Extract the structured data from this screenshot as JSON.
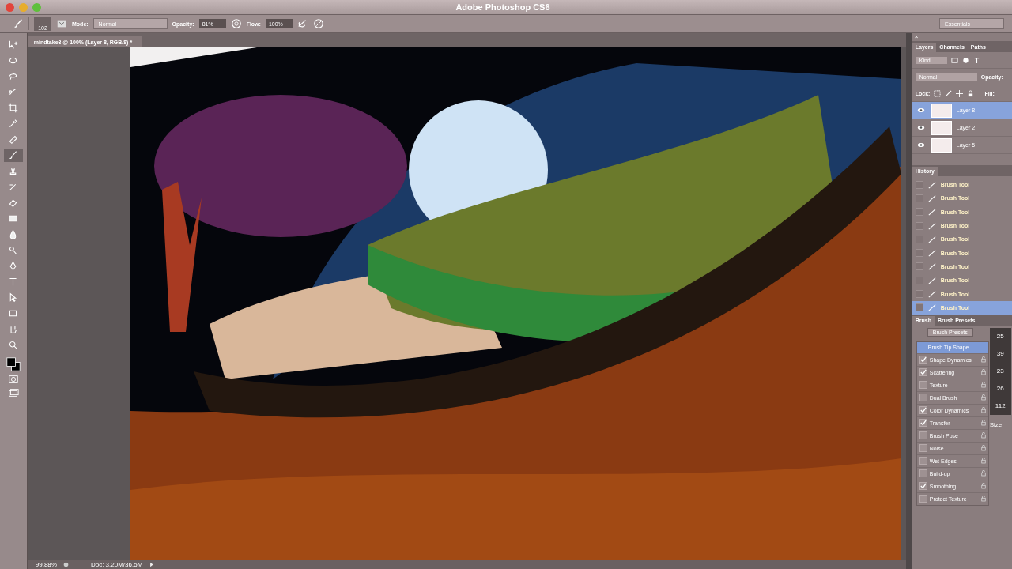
{
  "window": {
    "title": "Adobe Photoshop CS6"
  },
  "options_bar": {
    "brush_size": "102",
    "mode_label": "Mode:",
    "mode": "Normal",
    "opacity_label": "Opacity:",
    "opacity": "81%",
    "flow_label": "Flow:",
    "flow": "100%",
    "workspace": "Essentials"
  },
  "document_tab": {
    "title": "mindtake3 @ 100% (Layer 8, RGB/8) *"
  },
  "tools": [
    {
      "kind": "move",
      "selected": false
    },
    {
      "kind": "marquee",
      "selected": false
    },
    {
      "kind": "lasso",
      "selected": false
    },
    {
      "kind": "quick-select",
      "selected": false
    },
    {
      "kind": "crop",
      "selected": false
    },
    {
      "kind": "eyedropper",
      "selected": false
    },
    {
      "kind": "healing",
      "selected": false
    },
    {
      "kind": "brush",
      "selected": true
    },
    {
      "kind": "stamp",
      "selected": false
    },
    {
      "kind": "history-brush",
      "selected": false
    },
    {
      "kind": "eraser",
      "selected": false
    },
    {
      "kind": "gradient",
      "selected": false
    },
    {
      "kind": "blur",
      "selected": false
    },
    {
      "kind": "dodge",
      "selected": false
    },
    {
      "kind": "pen",
      "selected": false
    },
    {
      "kind": "type",
      "selected": false
    },
    {
      "kind": "path-select",
      "selected": false
    },
    {
      "kind": "shape",
      "selected": false
    },
    {
      "kind": "hand",
      "selected": false
    },
    {
      "kind": "zoom",
      "selected": false
    }
  ],
  "layers_panel": {
    "close": "×",
    "tabs": [
      {
        "label": "Layers",
        "selected": true
      },
      {
        "label": "Channels",
        "selected": false
      },
      {
        "label": "Paths",
        "selected": false
      }
    ],
    "filter": "Kind",
    "blend_mode": "Normal",
    "opacity_label": "Opacity:",
    "lock_label": "Lock:",
    "fill_label": "Fill:",
    "layers": [
      {
        "name": "Layer 8",
        "visible": true,
        "selected": true
      },
      {
        "name": "Layer 2",
        "visible": true,
        "selected": false
      },
      {
        "name": "Layer 5",
        "visible": true,
        "selected": false
      }
    ]
  },
  "history_panel": {
    "title": "History",
    "items": [
      {
        "label": "Brush Tool",
        "selected": false
      },
      {
        "label": "Brush Tool",
        "selected": false
      },
      {
        "label": "Brush Tool",
        "selected": false
      },
      {
        "label": "Brush Tool",
        "selected": false
      },
      {
        "label": "Brush Tool",
        "selected": false
      },
      {
        "label": "Brush Tool",
        "selected": false
      },
      {
        "label": "Brush Tool",
        "selected": false
      },
      {
        "label": "Brush Tool",
        "selected": false
      },
      {
        "label": "Brush Tool",
        "selected": false
      },
      {
        "label": "Brush Tool",
        "selected": true
      }
    ]
  },
  "brush_panel": {
    "tabs": [
      {
        "label": "Brush",
        "selected": true
      },
      {
        "label": "Brush Presets",
        "selected": false
      }
    ],
    "presets_button": "Brush Presets",
    "options": [
      {
        "kind": "heading",
        "label": "Brush Tip Shape",
        "selected": true
      },
      {
        "kind": "option",
        "label": "Shape Dynamics",
        "checked": true
      },
      {
        "kind": "option",
        "label": "Scattering",
        "checked": true
      },
      {
        "kind": "option",
        "label": "Texture",
        "checked": false
      },
      {
        "kind": "option",
        "label": "Dual Brush",
        "checked": false
      },
      {
        "kind": "option",
        "label": "Color Dynamics",
        "checked": true
      },
      {
        "kind": "option",
        "label": "Transfer",
        "checked": true
      },
      {
        "kind": "option",
        "label": "Brush Pose",
        "checked": false
      },
      {
        "kind": "option",
        "label": "Noise",
        "checked": false
      },
      {
        "kind": "option",
        "label": "Wet Edges",
        "checked": false
      },
      {
        "kind": "option",
        "label": "Build-up",
        "checked": false
      },
      {
        "kind": "option",
        "label": "Smoothing",
        "checked": true
      },
      {
        "kind": "option",
        "label": "Protect Texture",
        "checked": false
      }
    ],
    "tip_sizes": [
      "25",
      "39",
      "23",
      "26",
      "112"
    ],
    "size_label": "Size"
  },
  "status_bar": {
    "zoom": "99.88%",
    "doc": "Doc: 3.20M/36.5M"
  }
}
